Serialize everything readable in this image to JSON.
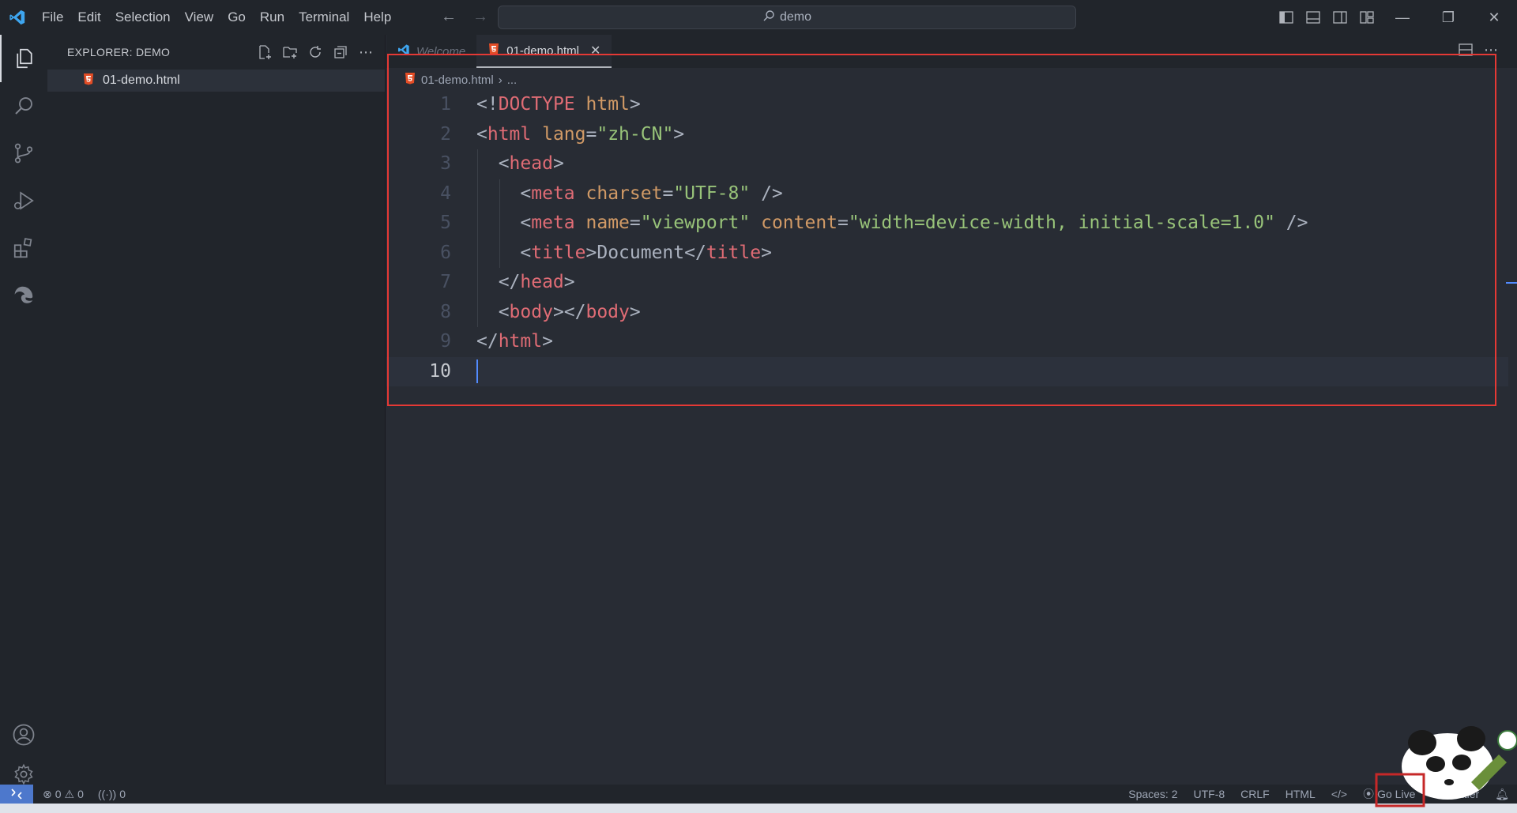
{
  "menu": [
    "File",
    "Edit",
    "Selection",
    "View",
    "Go",
    "Run",
    "Terminal",
    "Help"
  ],
  "search": {
    "text": "demo"
  },
  "sidebar": {
    "title": "EXPLORER: DEMO",
    "files": [
      {
        "name": "01-demo.html"
      }
    ]
  },
  "tabs": [
    {
      "label": "Welcome",
      "state": "inactive"
    },
    {
      "label": "01-demo.html",
      "state": "active"
    }
  ],
  "breadcrumb": {
    "file": "01-demo.html",
    "rest": "..."
  },
  "code": {
    "line_numbers": [
      "1",
      "2",
      "3",
      "4",
      "5",
      "6",
      "7",
      "8",
      "9",
      "10"
    ],
    "current_line": 10,
    "lines": [
      [
        {
          "t": "<!",
          "c": "punc"
        },
        {
          "t": "DOCTYPE",
          "c": "doctype"
        },
        {
          "t": " ",
          "c": "punc"
        },
        {
          "t": "html",
          "c": "kw"
        },
        {
          "t": ">",
          "c": "punc"
        }
      ],
      [
        {
          "t": "<",
          "c": "punc"
        },
        {
          "t": "html",
          "c": "tag"
        },
        {
          "t": " ",
          "c": "punc"
        },
        {
          "t": "lang",
          "c": "attr"
        },
        {
          "t": "=",
          "c": "punc"
        },
        {
          "t": "\"zh-CN\"",
          "c": "str"
        },
        {
          "t": ">",
          "c": "punc"
        }
      ],
      [
        {
          "t": "  <",
          "c": "punc"
        },
        {
          "t": "head",
          "c": "tag"
        },
        {
          "t": ">",
          "c": "punc"
        }
      ],
      [
        {
          "t": "    <",
          "c": "punc"
        },
        {
          "t": "meta",
          "c": "tag"
        },
        {
          "t": " ",
          "c": "punc"
        },
        {
          "t": "charset",
          "c": "attr"
        },
        {
          "t": "=",
          "c": "punc"
        },
        {
          "t": "\"UTF-8\"",
          "c": "str"
        },
        {
          "t": " />",
          "c": "punc"
        }
      ],
      [
        {
          "t": "    <",
          "c": "punc"
        },
        {
          "t": "meta",
          "c": "tag"
        },
        {
          "t": " ",
          "c": "punc"
        },
        {
          "t": "name",
          "c": "attr"
        },
        {
          "t": "=",
          "c": "punc"
        },
        {
          "t": "\"viewport\"",
          "c": "str"
        },
        {
          "t": " ",
          "c": "punc"
        },
        {
          "t": "content",
          "c": "attr"
        },
        {
          "t": "=",
          "c": "punc"
        },
        {
          "t": "\"width=device-width, initial-scale=1.0\"",
          "c": "str"
        },
        {
          "t": " />",
          "c": "punc"
        }
      ],
      [
        {
          "t": "    <",
          "c": "punc"
        },
        {
          "t": "title",
          "c": "tag"
        },
        {
          "t": ">Document</",
          "c": "punc"
        },
        {
          "t": "title",
          "c": "tag"
        },
        {
          "t": ">",
          "c": "punc"
        }
      ],
      [
        {
          "t": "  </",
          "c": "punc"
        },
        {
          "t": "head",
          "c": "tag"
        },
        {
          "t": ">",
          "c": "punc"
        }
      ],
      [
        {
          "t": "  <",
          "c": "punc"
        },
        {
          "t": "body",
          "c": "tag"
        },
        {
          "t": "></",
          "c": "punc"
        },
        {
          "t": "body",
          "c": "tag"
        },
        {
          "t": ">",
          "c": "punc"
        }
      ],
      [
        {
          "t": "</",
          "c": "punc"
        },
        {
          "t": "html",
          "c": "tag"
        },
        {
          "t": ">",
          "c": "punc"
        }
      ],
      []
    ]
  },
  "status": {
    "errors": "0",
    "warnings": "0",
    "ports": "0",
    "spaces": "Spaces: 2",
    "encoding": "UTF-8",
    "eol": "CRLF",
    "language": "HTML",
    "golive": "Go Live",
    "prettier": "Prettier"
  },
  "colors": {
    "accent": "#4d78cc",
    "highlight_box": "#e53935",
    "html_icon": "#e44d26"
  }
}
